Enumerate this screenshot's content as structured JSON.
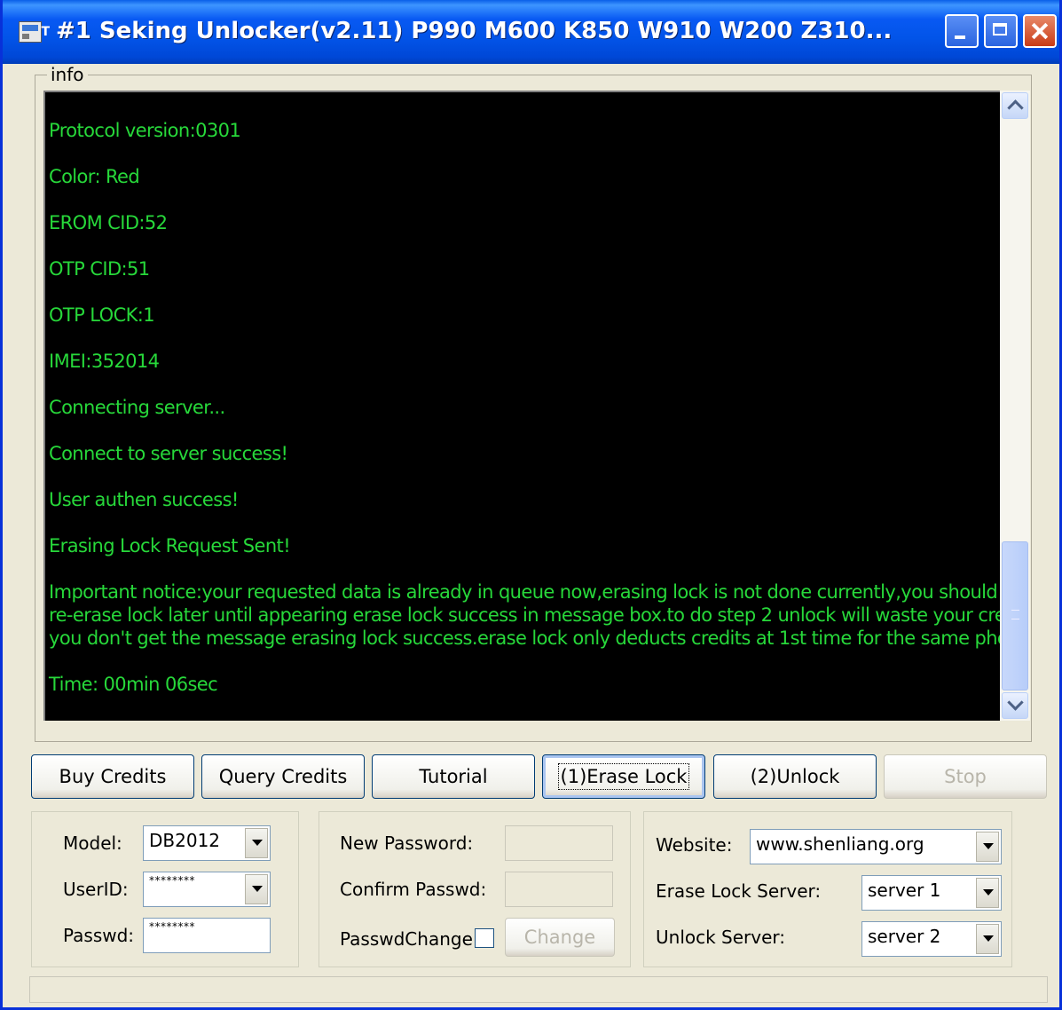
{
  "window": {
    "title": "#1 Seking Unlocker(v2.11) P990 M600 K850 W910 W200 Z310..."
  },
  "info": {
    "legend": "info",
    "log_lines": [
      "Protocol version:0301",
      "Color: Red",
      "EROM CID:52",
      "OTP CID:51",
      "OTP LOCK:1",
      "IMEI:352014",
      "Connecting server...",
      "Connect to server success!",
      "User authen success!",
      "Erasing Lock Request Sent!",
      "Important notice:your requested data is already in queue now,erasing lock is not done currently,you should",
      "re-erase lock later until appearing erase lock success in message box.to do step 2 unlock will waste your credit if",
      "you don't get the message erasing lock success.erase lock only deducts credits at 1st time for the same phone.",
      "Time: 00min 06sec"
    ]
  },
  "buttons": {
    "buy_credits": "Buy Credits",
    "query_credits": "Query Credits",
    "tutorial": "Tutorial",
    "erase_lock": "(1)Erase Lock",
    "unlock": "(2)Unlock",
    "stop": "Stop"
  },
  "account": {
    "model_label": "Model:",
    "model_value": "DB2012",
    "userid_label": "UserID:",
    "userid_value": "********",
    "passwd_label": "Passwd:",
    "passwd_value": "********"
  },
  "password": {
    "new_label": "New Password:",
    "confirm_label": "Confirm Passwd:",
    "change_label": "PasswdChange",
    "change_button": "Change"
  },
  "server": {
    "website_label": "Website:",
    "website_value": "www.shenliang.org",
    "erase_label": "Erase Lock Server:",
    "erase_value": "server 1",
    "unlock_label": "Unlock Server:",
    "unlock_value": "server 2"
  },
  "colors": {
    "log_text": "#27d83a",
    "log_background": "#000000",
    "window_face": "#ECE9D8",
    "titlebar": "#0054E3"
  }
}
